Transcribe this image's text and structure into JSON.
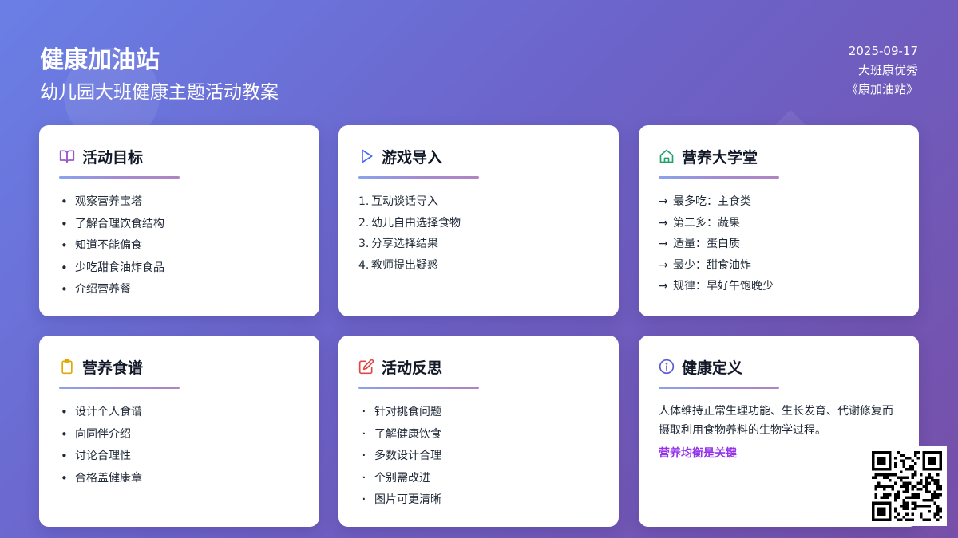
{
  "header": {
    "title": "健康加油站",
    "subtitle": "幼儿园大班健康主题活动教案",
    "date": "2025-09-17",
    "author": "大班康优秀",
    "work": "《康加油站》"
  },
  "cards": [
    {
      "title": "活动目标",
      "icon": "book-icon",
      "items": [
        "观察营养宝塔",
        "了解合理饮食结构",
        "知道不能偏食",
        "少吃甜食油炸食品",
        "介绍营养餐"
      ]
    },
    {
      "title": "游戏导入",
      "icon": "play-icon",
      "items": [
        "1.",
        "2.",
        "3.",
        "4."
      ],
      "numbered": [
        "互动谈话导入",
        "幼儿自由选择食物",
        "分享选择结果",
        "教师提出疑惑"
      ]
    },
    {
      "title": "营养大学堂",
      "icon": "home-icon",
      "arrow": "→",
      "items": [
        "最多吃：主食类",
        "第二多：蔬果",
        "适量：蛋白质",
        "最少：甜食油炸",
        "规律：早好午饱晚少"
      ]
    },
    {
      "title": "营养食谱",
      "icon": "clipboard-icon",
      "items": [
        "设计个人食谱",
        "向同伴介绍",
        "讨论合理性",
        "合格盖健康章"
      ]
    },
    {
      "title": "活动反思",
      "icon": "edit-icon",
      "items": [
        "针对挑食问题",
        "了解健康饮食",
        "多数设计合理",
        "个别需改进",
        "图片可更清晰"
      ]
    },
    {
      "title": "健康定义",
      "icon": "info-icon",
      "description": "人体维持正常生理功能、生长发育、代谢修复而摄取利用食物养料的生物学过程。",
      "highlight": "营养均衡是关键"
    }
  ],
  "colors": {
    "accent_purple": "#9333ea",
    "icon_purple": "#9b59d0",
    "icon_blue": "#4a6cf7",
    "icon_green": "#22a06b",
    "icon_yellow": "#e0a800",
    "icon_red": "#e04848",
    "icon_indigo": "#5b5bd6"
  }
}
